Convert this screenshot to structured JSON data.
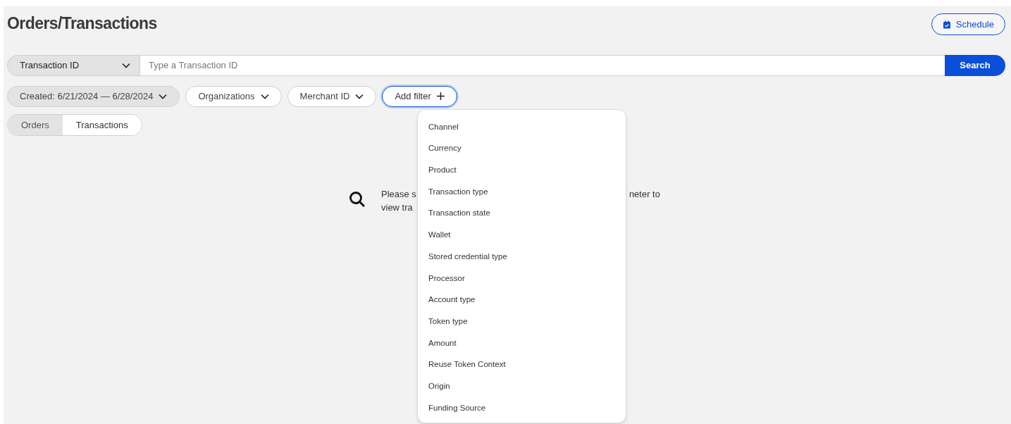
{
  "page": {
    "title": "Orders/Transactions"
  },
  "schedule_button": {
    "label": "Schedule"
  },
  "search": {
    "field_selector": "Transaction ID",
    "placeholder": "Type a Transaction ID",
    "button": "Search"
  },
  "filters": [
    {
      "label": "Created: 6/21/2024 — 6/28/2024",
      "kind": "applied"
    },
    {
      "label": "Organizations",
      "kind": "dropdown"
    },
    {
      "label": "Merchant ID",
      "kind": "dropdown"
    },
    {
      "label": "Add filter",
      "kind": "add"
    }
  ],
  "view_tabs": [
    {
      "label": "Orders",
      "selected": false
    },
    {
      "label": "Transactions",
      "selected": true
    }
  ],
  "empty_state": {
    "line_1_start": "Please s",
    "line_1_end": "neter to",
    "line_2_start": "view tra"
  },
  "add_filter_menu": [
    "Channel",
    "Currency",
    "Product",
    "Transaction type",
    "Transaction state",
    "Wallet",
    "Stored credential type",
    "Processor",
    "Account type",
    "Token type",
    "Amount",
    "Reuse Token Context",
    "Origin",
    "Funding Source"
  ]
}
